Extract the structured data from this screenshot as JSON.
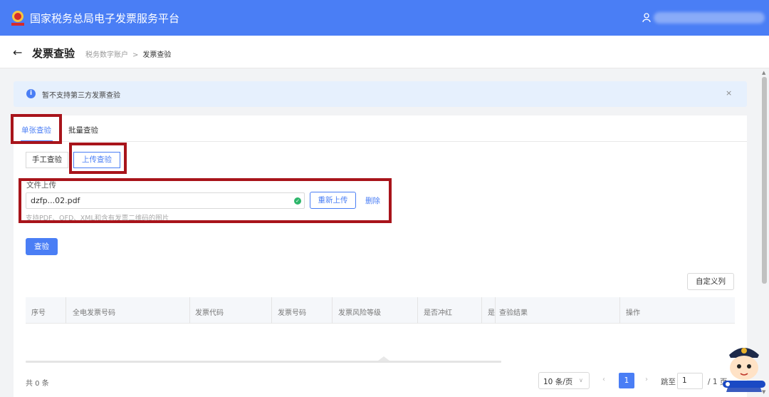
{
  "header": {
    "app_title": "国家税务总局电子发票服务平台",
    "user_name": ""
  },
  "subheader": {
    "back_glyph": "←",
    "page_title": "发票查验",
    "breadcrumb": [
      "税务数字账户",
      "发票查验"
    ],
    "breadcrumb_sep": ">"
  },
  "alert": {
    "icon": "info-icon",
    "icon_glyph": "i",
    "text": "暂不支持第三方发票查验",
    "close_glyph": "×"
  },
  "tabs": [
    {
      "label": "单张查验",
      "active": true
    },
    {
      "label": "批量查验",
      "active": false
    }
  ],
  "modes": [
    {
      "label": "手工查验",
      "active": false
    },
    {
      "label": "上传查验",
      "active": true
    }
  ],
  "upload": {
    "label": "文件上传",
    "file_name": "dzfp...02.pdf",
    "status_icon": "check-circle-icon",
    "reupload_label": "重新上传",
    "delete_label": "删除",
    "hint": "支持PDF、OFD、XML和含有发票二维码的图片"
  },
  "actions": {
    "verify_label": "查验",
    "custom_columns_label": "自定义列"
  },
  "table": {
    "columns": [
      "序号",
      "全电发票号码",
      "发票代码",
      "发票号码",
      "发票风险等级",
      "是否冲红",
      "是",
      "查验结果",
      "操作"
    ],
    "rows": []
  },
  "pagination": {
    "total_text": "共 0 条",
    "page_size": "10 条/页",
    "prev_glyph": "‹",
    "current_page": "1",
    "next_glyph": "›",
    "jump_label": "跳至",
    "jump_value": "1",
    "total_pages_text": "/ 1 页"
  },
  "colors": {
    "primary": "#4a7ef5",
    "highlight_border": "#a8141b",
    "success": "#2db66a"
  }
}
